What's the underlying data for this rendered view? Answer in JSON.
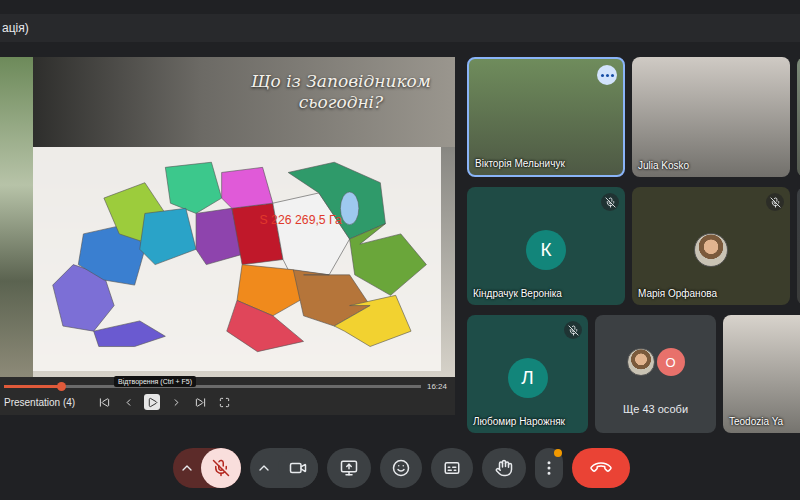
{
  "window": {
    "title": "ація)"
  },
  "presentation": {
    "slide_title": "Що із Заповідником сьогодні?",
    "area_label": "S 226 269,5 Га",
    "file_name": "Presentation (4)",
    "time": "16:24",
    "progress": 0.14,
    "tooltip": "Відтворення (Ctrl + F5)"
  },
  "participant_rows": [
    [
      {
        "kind": "video",
        "name": "Вікторія Мельничук",
        "muted": false,
        "speaking": true,
        "color": "#6f8c5c"
      },
      {
        "kind": "video",
        "name": "Julia Kosko",
        "muted": false,
        "speaking": false,
        "color": "#cfcac4"
      },
      {
        "kind": "partial",
        "color": "#7d8c7a"
      }
    ],
    [
      {
        "kind": "avatar",
        "name": "Кіндрачук Вероніка",
        "initial": "К",
        "muted": true,
        "speaking": false,
        "color": "#1f4b45",
        "avatar_color": "#12857a"
      },
      {
        "kind": "photo",
        "name": "Марія Орфанова",
        "muted": true,
        "speaking": false,
        "color": "#3b3d2b"
      },
      {
        "kind": "partial",
        "color": "#3c4043"
      }
    ],
    [
      {
        "kind": "avatar",
        "name": "Любомир Нарожняк",
        "initial": "Л",
        "muted": true,
        "speaking": false,
        "color": "#1e4d48",
        "avatar_color": "#12857a"
      },
      {
        "kind": "more",
        "label": "Ще 43 особи",
        "initial": "О",
        "avatar_color": "#e8716b",
        "color": "#3c4043"
      },
      {
        "kind": "video",
        "name": "Teodozia Ya",
        "muted": false,
        "speaking": false,
        "color": "#d8d3cc"
      }
    ]
  ],
  "controls": [
    {
      "kind": "mic",
      "on": false
    },
    {
      "kind": "camera",
      "on": true
    },
    {
      "kind": "present",
      "on": false
    },
    {
      "kind": "reactions",
      "on": false
    },
    {
      "kind": "captions",
      "on": false
    },
    {
      "kind": "raise-hand",
      "on": false
    },
    {
      "kind": "more",
      "on": false,
      "badge": true
    },
    {
      "kind": "leave",
      "on": false
    }
  ]
}
